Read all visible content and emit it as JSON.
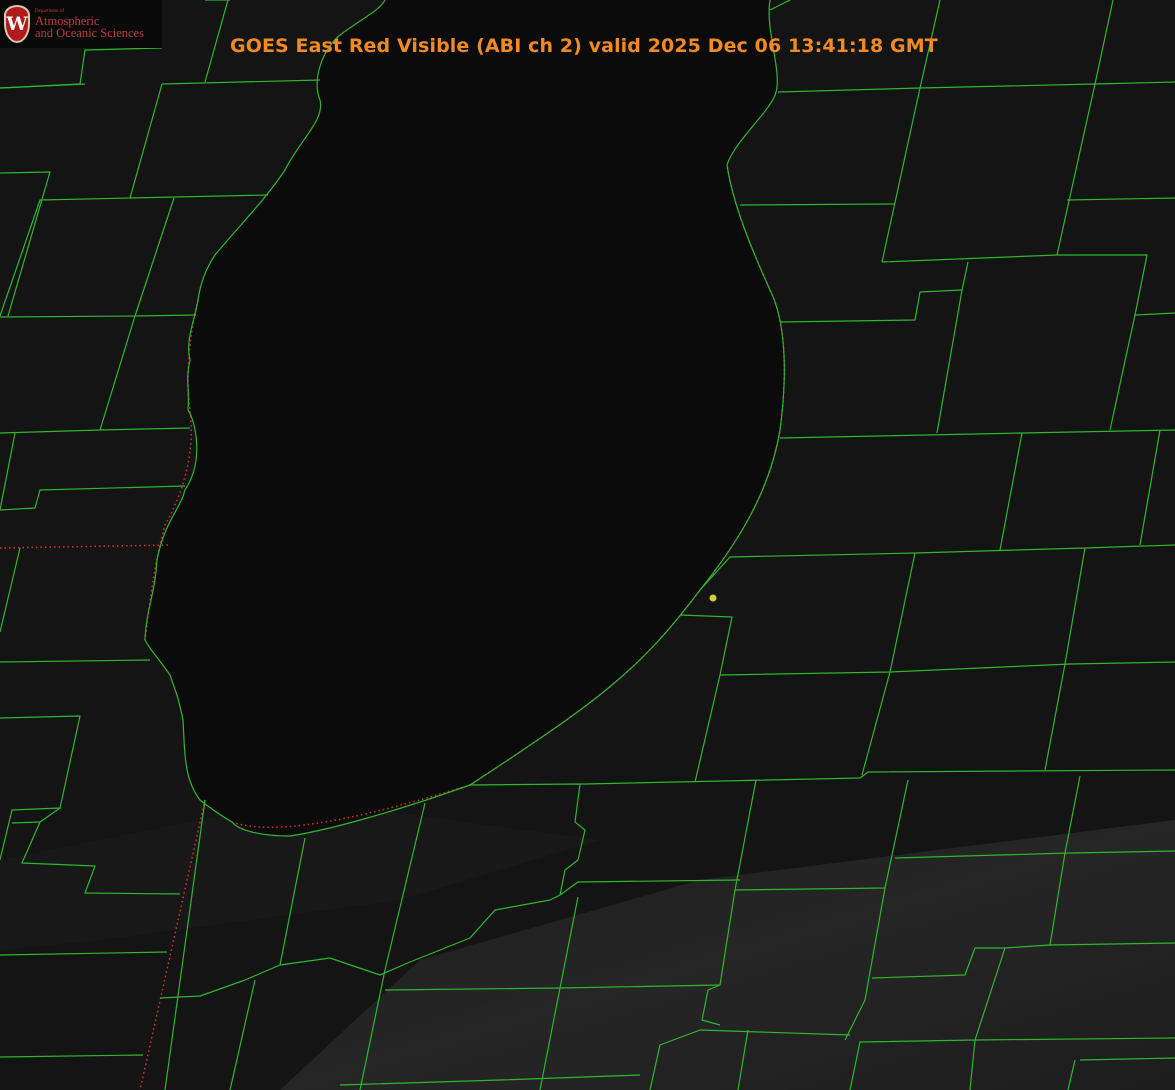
{
  "title": "GOES East Red Visible (ABI ch 2) valid 2025 Dec 06 13:41:18 GMT",
  "logo": {
    "crest_letter": "W",
    "department": "Department of",
    "line1": "Atmospheric",
    "line2": "and Oceanic Sciences"
  },
  "colors": {
    "title": "#f08a24",
    "background": "#141414",
    "lake": "#0b0b0b",
    "boundaries": "#2fb62f",
    "state_line": "#d93030",
    "marker": "#d6cf2a",
    "logo_text": "#c33a3a",
    "crest": "#b01c1c"
  },
  "map": {
    "layers": [
      "county-boundaries",
      "state-boundaries",
      "lake-shoreline"
    ],
    "marker_icon": "location-dot-icon"
  }
}
